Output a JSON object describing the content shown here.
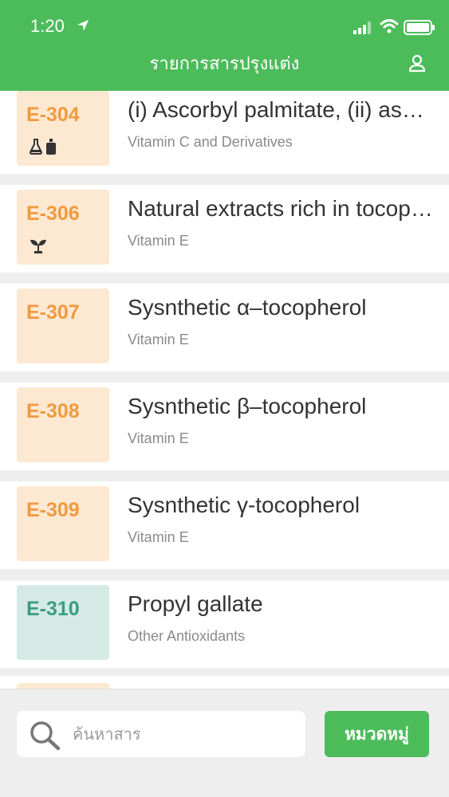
{
  "status_bar": {
    "time": "1:20"
  },
  "header": {
    "title": "รายการสารปรุงแต่ง"
  },
  "items": [
    {
      "code": "E-304",
      "name": "(i) Ascorbyl palmitate, (ii) ascorbyl stearate",
      "category": "Vitamin C and Derivatives",
      "color": "orange",
      "icons": [
        "flask-icon",
        "bottle-icon"
      ]
    },
    {
      "code": "E-306",
      "name": "Natural extracts rich in tocopherols",
      "category": "Vitamin E",
      "color": "orange",
      "icons": [
        "sprout-icon"
      ]
    },
    {
      "code": "E-307",
      "name": "Sysnthetic α–tocopherol",
      "category": "Vitamin E",
      "color": "orange",
      "icons": []
    },
    {
      "code": "E-308",
      "name": "Sysnthetic β–tocopherol",
      "category": "Vitamin E",
      "color": "orange",
      "icons": []
    },
    {
      "code": "E-309",
      "name": "Sysnthetic γ-tocopherol",
      "category": "Vitamin E",
      "color": "orange",
      "icons": []
    },
    {
      "code": "E-310",
      "name": "Propyl gallate",
      "category": "Other Antioxidants",
      "color": "teal",
      "icons": []
    }
  ],
  "search": {
    "placeholder": "ค้นหาสาร",
    "value": ""
  },
  "category_button": {
    "label": "หมวดหมู่"
  },
  "colors": {
    "brand_green": "#4cbc5a",
    "orange_bg": "#fde8d2",
    "orange_text": "#f09a3e",
    "teal_bg": "#d5eae4",
    "teal_text": "#3a9c7f"
  }
}
